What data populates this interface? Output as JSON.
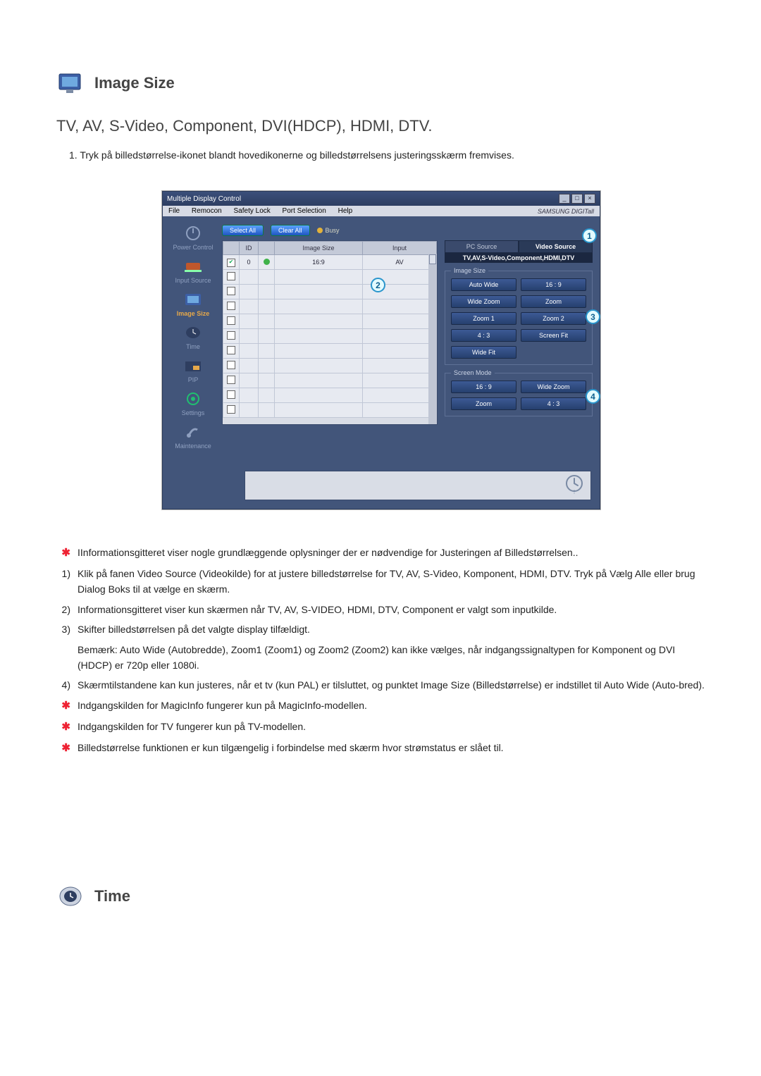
{
  "section": {
    "title": "Image Size",
    "subtitle": "TV, AV, S-Video, Component, DVI(HDCP), HDMI, DTV.",
    "intro_num": "1.",
    "intro": "Tryk på billedstørrelse-ikonet blandt hovedikonerne og billedstørrelsens justeringsskærm fremvises."
  },
  "app": {
    "title": "Multiple Display Control",
    "menus": [
      "File",
      "Remocon",
      "Safety Lock",
      "Port Selection",
      "Help"
    ],
    "brand": "SAMSUNG DIGITall",
    "toolbar": {
      "select_all": "Select All",
      "clear_all": "Clear All",
      "busy": "Busy"
    },
    "sidebar": [
      {
        "label": "Power Control",
        "icon": "power-icon",
        "active": false
      },
      {
        "label": "Input Source",
        "icon": "input-icon",
        "active": false
      },
      {
        "label": "Image Size",
        "icon": "image-size-icon",
        "active": true
      },
      {
        "label": "Time",
        "icon": "time-icon",
        "active": false
      },
      {
        "label": "PIP",
        "icon": "pip-icon",
        "active": false
      },
      {
        "label": "Settings",
        "icon": "settings-icon",
        "active": false
      },
      {
        "label": "Maintenance",
        "icon": "maintenance-icon",
        "active": false
      }
    ],
    "grid": {
      "headers": [
        "",
        "ID",
        "",
        "Image Size",
        "Input"
      ],
      "rows": [
        {
          "checked": true,
          "id": "0",
          "led": true,
          "size": "16:9",
          "input": "AV"
        },
        {
          "checked": false,
          "id": "",
          "led": false,
          "size": "",
          "input": ""
        },
        {
          "checked": false,
          "id": "",
          "led": false,
          "size": "",
          "input": ""
        },
        {
          "checked": false,
          "id": "",
          "led": false,
          "size": "",
          "input": ""
        },
        {
          "checked": false,
          "id": "",
          "led": false,
          "size": "",
          "input": ""
        },
        {
          "checked": false,
          "id": "",
          "led": false,
          "size": "",
          "input": ""
        },
        {
          "checked": false,
          "id": "",
          "led": false,
          "size": "",
          "input": ""
        },
        {
          "checked": false,
          "id": "",
          "led": false,
          "size": "",
          "input": ""
        },
        {
          "checked": false,
          "id": "",
          "led": false,
          "size": "",
          "input": ""
        },
        {
          "checked": false,
          "id": "",
          "led": false,
          "size": "",
          "input": ""
        },
        {
          "checked": false,
          "id": "",
          "led": false,
          "size": "",
          "input": ""
        }
      ]
    },
    "panel": {
      "pc_tab": "PC Source",
      "video_tab": "Video Source",
      "sources_line": "TV,AV,S-Video,Component,HDMI,DTV",
      "image_size_legend": "Image Size",
      "image_size_buttons": [
        "Auto Wide",
        "16 : 9",
        "Wide Zoom",
        "Zoom",
        "Zoom 1",
        "Zoom 2",
        "4 : 3",
        "Screen Fit",
        "Wide Fit"
      ],
      "screen_mode_legend": "Screen Mode",
      "screen_mode_buttons": [
        "16 : 9",
        "Wide Zoom",
        "Zoom",
        "4 : 3"
      ]
    },
    "callouts": {
      "c1": "1",
      "c2": "2",
      "c3": "3",
      "c4": "4"
    }
  },
  "notes": [
    {
      "m": "star",
      "text": "IInformationsgitteret viser nogle grundlæggende oplysninger der er nødvendige for Justeringen af Billedstørrelsen.."
    },
    {
      "m": "1)",
      "text": "Klik på fanen Video Source (Videokilde) for at justere billedstørrelse for TV, AV, S-Video, Komponent, HDMI, DTV. Tryk på Vælg Alle eller brug Dialog Boks til at vælge en skærm."
    },
    {
      "m": "2)",
      "text": "Informationsgitteret viser kun skærmen når TV, AV, S-VIDEO, HDMI, DTV, Component er valgt som inputkilde."
    },
    {
      "m": "3)",
      "text": "Skifter billedstørrelsen på det valgte display tilfældigt."
    },
    {
      "m": "",
      "text": "Bemærk: Auto Wide (Autobredde), Zoom1 (Zoom1) og Zoom2 (Zoom2) kan ikke vælges, når indgangssignaltypen for Komponent og DVI (HDCP) er 720p eller 1080i."
    },
    {
      "m": "4)",
      "text": "Skærmtilstandene kan kun justeres, når et tv (kun PAL) er tilsluttet, og punktet Image Size (Billedstørrelse) er indstillet til Auto Wide (Auto-bred)."
    },
    {
      "m": "star",
      "text": "Indgangskilden for MagicInfo fungerer kun på MagicInfo-modellen."
    },
    {
      "m": "star",
      "text": "Indgangskilden for TV fungerer kun på TV-modellen."
    },
    {
      "m": "star",
      "text": "Billedstørrelse funktionen er kun tilgængelig i forbindelse med skærm hvor strømstatus er slået til."
    }
  ],
  "time_section": {
    "title": "Time"
  }
}
